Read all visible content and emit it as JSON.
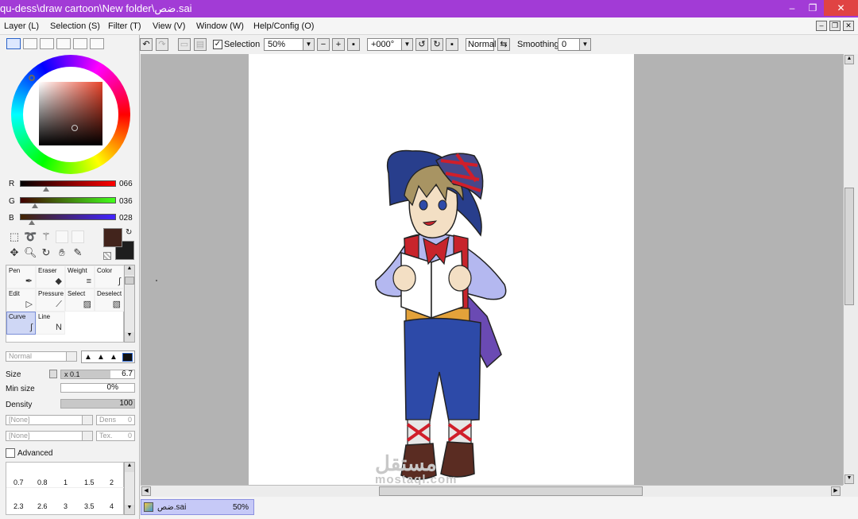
{
  "title": "qu-dess\\draw cartoon\\New folder\\ضص.sai",
  "window_controls": {
    "minimize": "–",
    "restore": "❐",
    "close": "✕"
  },
  "menu": [
    {
      "label": "Layer (L)"
    },
    {
      "label": "Selection (S)"
    },
    {
      "label": "Filter (T)"
    },
    {
      "label": "View (V)"
    },
    {
      "label": "Window (W)"
    },
    {
      "label": "Help/Config (O)"
    }
  ],
  "color": {
    "r_label": "R",
    "r_value": "066",
    "g_label": "G",
    "g_value": "036",
    "b_label": "B",
    "b_value": "028",
    "r": 66,
    "g": 36,
    "b": 28,
    "foreground": "#42241c",
    "background": "#1e1e1e"
  },
  "tools": [
    {
      "name": "Pen",
      "icon": "pen-icon"
    },
    {
      "name": "Eraser",
      "icon": "eraser-icon"
    },
    {
      "name": "Weight",
      "icon": "weight-icon"
    },
    {
      "name": "Color",
      "icon": "color-icon"
    },
    {
      "name": "Edit",
      "icon": "cursor-icon"
    },
    {
      "name": "Pressure",
      "icon": "pressure-icon"
    },
    {
      "name": "Select",
      "icon": "select-icon"
    },
    {
      "name": "Deselect",
      "icon": "deselect-icon"
    },
    {
      "name": "Curve",
      "icon": "curve-icon",
      "selected": true
    },
    {
      "name": "Line",
      "icon": "line-icon"
    }
  ],
  "brush": {
    "blend_mode": "Normal",
    "size_label": "Size",
    "size_multiplier": "x 0.1",
    "size_value": "6.7",
    "min_size_label": "Min size",
    "min_size_value": "0%",
    "density_label": "Density",
    "density_value": "100",
    "texture1": "[None]",
    "dens_label": "Dens",
    "dens_value": "0",
    "texture2": "[None]",
    "tex_label": "Tex.",
    "tex_value": "0",
    "advanced_label": "Advanced",
    "presets_row1": [
      "0.7",
      "0.8",
      "1",
      "1.5",
      "2"
    ],
    "presets_row2": [
      "2.3",
      "2.6",
      "3",
      "3.5",
      "4"
    ]
  },
  "toolbar": {
    "selection_label": "Selection",
    "zoom": "50%",
    "rotation": "+000°",
    "blend": "Normal",
    "smoothing_label": "Smoothing",
    "smoothing_value": "0"
  },
  "document_tab": {
    "name": "ضص.sai",
    "zoom": "50%"
  },
  "watermark": {
    "arabic": "مستقل",
    "latin": "mostaql.com"
  },
  "colors": {
    "titlebar": "#a23bd6",
    "canvas_bg": "#b3b3b3",
    "tab": "#c6c9f7",
    "hat": "#283e8c",
    "pants": "#2d4aa8",
    "vest": "#c8242c",
    "shirt": "#b4b8f0",
    "hair": "#a89463",
    "boots": "#5a2c22"
  }
}
